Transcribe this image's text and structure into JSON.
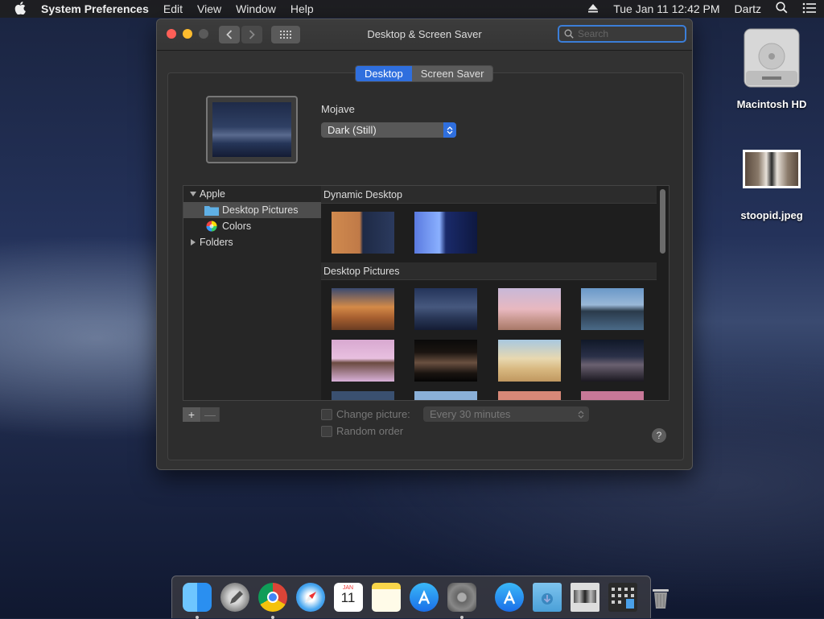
{
  "menubar": {
    "app": "System Preferences",
    "menus": [
      "Edit",
      "View",
      "Window",
      "Help"
    ],
    "clock": "Tue Jan 11  12:42 PM",
    "user": "Dartz"
  },
  "window": {
    "title": "Desktop & Screen Saver",
    "search_placeholder": "Search",
    "tabs": [
      "Desktop",
      "Screen Saver"
    ],
    "selected_tab": "Desktop",
    "wallpaper_name": "Mojave",
    "wallpaper_mode": "Dark (Still)",
    "sources": {
      "apple": "Apple",
      "desktop_pictures": "Desktop Pictures",
      "colors": "Colors",
      "folders": "Folders"
    },
    "sections": {
      "dynamic": "Dynamic Desktop",
      "pictures": "Desktop Pictures"
    },
    "change_picture_label": "Change picture:",
    "change_interval": "Every 30 minutes",
    "random_order_label": "Random order",
    "help": "?",
    "add": "+",
    "remove": "—"
  },
  "desktop_icons": {
    "hd": "Macintosh HD",
    "file": "stoopid.jpeg"
  },
  "dock_calendar": {
    "month": "JAN",
    "day": "11"
  },
  "colors": {
    "accent": "#2f6fde",
    "close": "#fe5f57",
    "minimize": "#febc2e"
  }
}
